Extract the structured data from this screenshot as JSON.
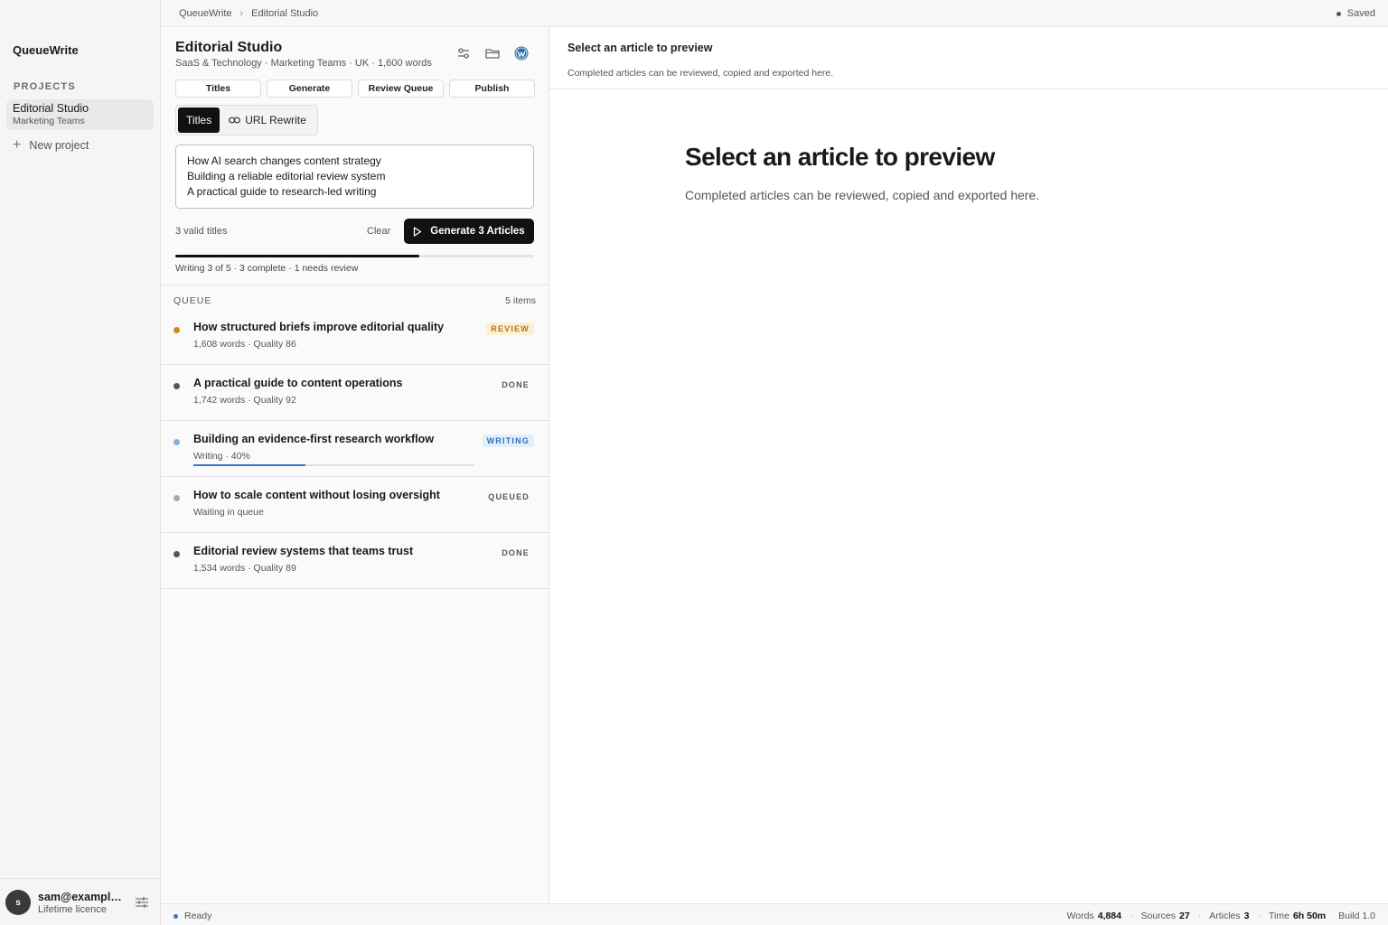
{
  "sidebar": {
    "brand": "QueueWrite",
    "section_label": "PROJECTS",
    "projects": [
      {
        "name": "Editorial Studio",
        "subtitle": "Marketing Teams"
      }
    ],
    "new_project_label": "New project",
    "user": {
      "initial": "s",
      "email": "sam@example.com",
      "plan": "Lifetime licence"
    }
  },
  "topbar": {
    "breadcrumb": [
      "QueueWrite",
      "Editorial Studio"
    ],
    "breadcrumb_separator": "›",
    "saved_label": "Saved"
  },
  "editor": {
    "title": "Editorial Studio",
    "subtitle": "SaaS & Technology · Marketing Teams · UK · 1,600 words",
    "tabs": [
      "Titles",
      "Generate",
      "Review Queue",
      "Publish"
    ],
    "mode_active": "Titles",
    "mode_other": "URL Rewrite",
    "titles_input": "How AI search changes content strategy\nBuilding a reliable editorial review system\nA practical guide to research-led writing",
    "valid_count_label": "3 valid titles",
    "clear_label": "Clear",
    "generate_label": "Generate 3 Articles",
    "progress_fraction": 0.68,
    "progress_text": "Writing 3 of 5 · 3 complete · 1 needs review"
  },
  "queue": {
    "label": "QUEUE",
    "count_label": "5 items",
    "items": [
      {
        "title": "How structured briefs improve editorial quality",
        "meta": "1,608 words · Quality 86",
        "status": "REVIEW",
        "dot_color": "#d08a1a",
        "badge_color": "#b8740e",
        "badge_bg": "#fbefd6"
      },
      {
        "title": "A practical guide to content operations",
        "meta": "1,742 words · Quality 92",
        "status": "DONE",
        "dot_color": "#555555",
        "badge_color": "#555555",
        "badge_bg": "transparent"
      },
      {
        "title": "Building an evidence-first research workflow",
        "meta": "Writing · 40%",
        "status": "WRITING",
        "dot_color": "#7fb0e6",
        "badge_color": "#2f6fbf",
        "badge_bg": "#e4eefa",
        "progress": 0.4
      },
      {
        "title": "How to scale content without losing oversight",
        "meta": "Waiting in queue",
        "status": "QUEUED",
        "dot_color": "#a8a8a8",
        "badge_color": "#555555",
        "badge_bg": "transparent"
      },
      {
        "title": "Editorial review systems that teams trust",
        "meta": "1,534 words · Quality 89",
        "status": "DONE",
        "dot_color": "#555555",
        "badge_color": "#555555",
        "badge_bg": "transparent"
      }
    ]
  },
  "preview": {
    "header_title": "Select an article to preview",
    "header_sub": "Completed articles can be reviewed, copied and exported here.",
    "big_title": "Select an article to preview",
    "description": "Completed articles can be reviewed, copied and exported here."
  },
  "statusbar": {
    "status": "Ready",
    "stats": [
      {
        "label": "Words",
        "value": "4,884"
      },
      {
        "label": "Sources",
        "value": "27"
      },
      {
        "label": "Articles",
        "value": "3"
      },
      {
        "label": "Time",
        "value": "6h 50m"
      }
    ],
    "build": "Build 1.0"
  }
}
